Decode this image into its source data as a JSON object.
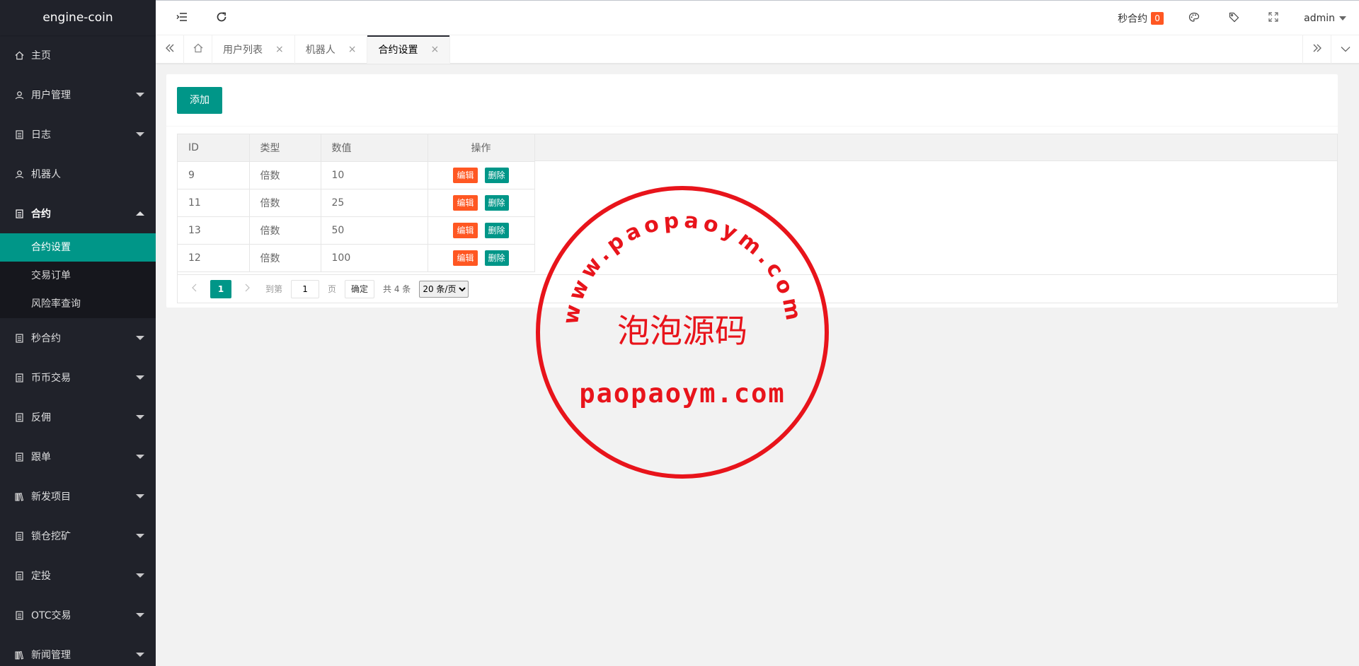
{
  "app": {
    "title": "engine-coin"
  },
  "sidebar": {
    "items": [
      {
        "label": "主页",
        "icon": "home-icon",
        "has_arrow": false
      },
      {
        "label": "用户管理",
        "icon": "user-icon",
        "has_arrow": true
      },
      {
        "label": "日志",
        "icon": "document-icon",
        "has_arrow": true
      },
      {
        "label": "机器人",
        "icon": "user-icon",
        "has_arrow": false
      },
      {
        "label": "合约",
        "icon": "document-icon",
        "has_arrow": true,
        "open": true
      }
    ],
    "subitems": [
      {
        "label": "合约设置",
        "active": true
      },
      {
        "label": "交易订单",
        "active": false
      },
      {
        "label": "风险率查询",
        "active": false
      }
    ],
    "items_after": [
      {
        "label": "秒合约",
        "icon": "document-icon"
      },
      {
        "label": "币币交易",
        "icon": "document-icon"
      },
      {
        "label": "反佣",
        "icon": "document-icon"
      },
      {
        "label": "跟单",
        "icon": "document-icon"
      },
      {
        "label": "新发项目",
        "icon": "list-icon"
      },
      {
        "label": "锁仓挖矿",
        "icon": "document-icon"
      },
      {
        "label": "定投",
        "icon": "document-icon"
      },
      {
        "label": "OTC交易",
        "icon": "document-icon"
      },
      {
        "label": "新闻管理",
        "icon": "list-icon"
      }
    ]
  },
  "header": {
    "second_contract_label": "秒合约",
    "second_contract_count": "0",
    "user": "admin",
    "icons": [
      "menu-fold-icon",
      "refresh-icon",
      "palette-icon",
      "tag-icon",
      "fullscreen-icon"
    ]
  },
  "tabs": [
    {
      "label": "用户列表",
      "active": false
    },
    {
      "label": "机器人",
      "active": false
    },
    {
      "label": "合约设置",
      "active": true
    }
  ],
  "toolbar": {
    "add_label": "添加"
  },
  "table": {
    "headers": {
      "id": "ID",
      "type": "类型",
      "value": "数值",
      "action": "操作"
    },
    "rows": [
      {
        "id": "9",
        "type": "倍数",
        "value": "10"
      },
      {
        "id": "11",
        "type": "倍数",
        "value": "25"
      },
      {
        "id": "13",
        "type": "倍数",
        "value": "50"
      },
      {
        "id": "12",
        "type": "倍数",
        "value": "100"
      }
    ],
    "edit_label": "编辑",
    "delete_label": "删除"
  },
  "pager": {
    "current": "1",
    "goto_label": "到第",
    "goto_value": "1",
    "page_label": "页",
    "confirm_label": "确定",
    "total_label": "共 4 条",
    "page_size": "20 条/页"
  },
  "watermark": {
    "arc_text": "www.paopaoym.com",
    "center_text": "泡泡源码",
    "bottom_text": "paopaoym.com",
    "color": "#e8141b"
  },
  "colors": {
    "primary": "#009688",
    "danger": "#ff5722",
    "sidebar": "#20222a"
  }
}
